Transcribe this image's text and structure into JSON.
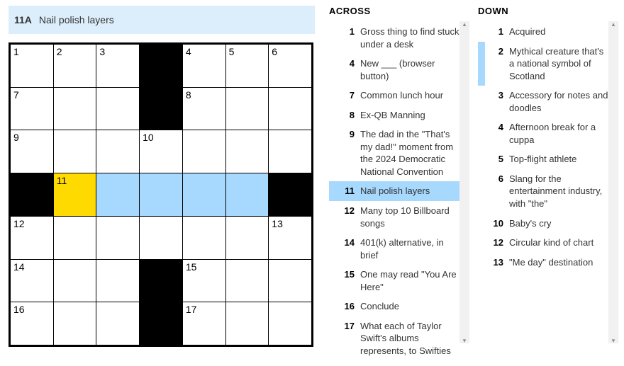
{
  "currentClue": {
    "label": "11A",
    "text": "Nail polish layers"
  },
  "grid": {
    "cols": 7,
    "rows": 7,
    "cells": [
      [
        {
          "n": "1"
        },
        {
          "n": "2"
        },
        {
          "n": "3"
        },
        {
          "b": true
        },
        {
          "n": "4"
        },
        {
          "n": "5"
        },
        {
          "n": "6"
        }
      ],
      [
        {
          "n": "7"
        },
        {},
        {},
        {
          "b": true
        },
        {
          "n": "8"
        },
        {},
        {}
      ],
      [
        {
          "n": "9"
        },
        {},
        {},
        {
          "n": "10"
        },
        {},
        {},
        {}
      ],
      [
        {
          "b": true
        },
        {
          "n": "11",
          "cur": true
        },
        {
          "sel": true
        },
        {
          "sel": true
        },
        {
          "sel": true
        },
        {
          "sel": true
        },
        {
          "b": true
        }
      ],
      [
        {
          "n": "12"
        },
        {},
        {},
        {},
        {},
        {},
        {
          "n": "13"
        }
      ],
      [
        {
          "n": "14"
        },
        {},
        {},
        {
          "b": true
        },
        {
          "n": "15"
        },
        {},
        {}
      ],
      [
        {
          "n": "16"
        },
        {},
        {},
        {
          "b": true
        },
        {
          "n": "17"
        },
        {},
        {}
      ]
    ]
  },
  "across": {
    "title": "ACROSS",
    "clues": [
      {
        "n": "1",
        "t": "Gross thing to find stuck under a desk"
      },
      {
        "n": "4",
        "t": "New ___ (browser button)"
      },
      {
        "n": "7",
        "t": "Common lunch hour"
      },
      {
        "n": "8",
        "t": "Ex-QB Manning"
      },
      {
        "n": "9",
        "t": "The dad in the \"That's my dad!\" moment from the 2024 Democratic National Convention"
      },
      {
        "n": "11",
        "t": "Nail polish layers",
        "cur": true
      },
      {
        "n": "12",
        "t": "Many top 10 Billboard songs"
      },
      {
        "n": "14",
        "t": "401(k) alternative, in brief"
      },
      {
        "n": "15",
        "t": "One may read \"You Are Here\""
      },
      {
        "n": "16",
        "t": "Conclude"
      },
      {
        "n": "17",
        "t": "What each of Taylor Swift's albums represents, to Swifties"
      }
    ]
  },
  "down": {
    "title": "DOWN",
    "clues": [
      {
        "n": "1",
        "t": "Acquired"
      },
      {
        "n": "2",
        "t": "Mythical creature that's a national symbol of Scotland",
        "hl": true
      },
      {
        "n": "3",
        "t": "Accessory for notes and doodles"
      },
      {
        "n": "4",
        "t": "Afternoon break for a cuppa"
      },
      {
        "n": "5",
        "t": "Top-flight athlete"
      },
      {
        "n": "6",
        "t": "Slang for the entertainment industry, with \"the\""
      },
      {
        "n": "10",
        "t": "Baby's cry"
      },
      {
        "n": "12",
        "t": "Circular kind of chart"
      },
      {
        "n": "13",
        "t": "\"Me day\" destination"
      }
    ]
  }
}
